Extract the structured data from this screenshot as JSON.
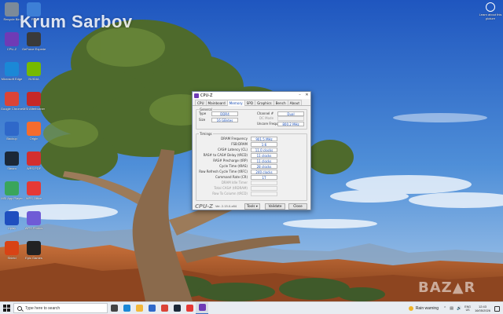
{
  "watermark": {
    "text": "Krum Sarbov"
  },
  "desktop_icons": [
    {
      "label": "Recycle Bin",
      "icon": "recycle-bin-icon",
      "color": "#7c8a99"
    },
    {
      "label": "File",
      "icon": "file-icon",
      "color": "#3d7fd6"
    },
    {
      "label": "CPU-Z",
      "icon": "cpuz-icon",
      "color": "#6f3bb5"
    },
    {
      "label": "GeForce Experience",
      "icon": "geforce-icon",
      "color": "#3a3a3a"
    },
    {
      "label": "Microsoft Edge",
      "icon": "edge-icon",
      "color": "#1b88d6"
    },
    {
      "label": "NVIDIA",
      "icon": "nvidia-icon",
      "color": "#76b900"
    },
    {
      "label": "Google Chrome",
      "icon": "chrome-icon",
      "color": "#db4437"
    },
    {
      "label": "MSI Afterburner",
      "icon": "afterburner-icon",
      "color": "#c62828"
    },
    {
      "label": "Backup",
      "icon": "backup-icon",
      "color": "#2f68c9"
    },
    {
      "label": "Origin",
      "icon": "origin-icon",
      "color": "#f56c2d"
    },
    {
      "label": "Steam",
      "icon": "steam-icon",
      "color": "#1b2838"
    },
    {
      "label": "WPS PDF",
      "icon": "pdf-icon",
      "color": "#d32f2f"
    },
    {
      "label": "MSI App Player",
      "icon": "player-icon",
      "color": "#3aa55b"
    },
    {
      "label": "WPS Office",
      "icon": "wps-icon",
      "color": "#e53935"
    },
    {
      "label": "Uplay",
      "icon": "ubisoft-icon",
      "color": "#1f4fbf"
    },
    {
      "label": "WPS Photos",
      "icon": "photos-icon",
      "color": "#6f5bd6"
    },
    {
      "label": "Shield",
      "icon": "shield-icon",
      "color": "#d84315"
    },
    {
      "label": "Epic Games",
      "icon": "epic-icon",
      "color": "#222222"
    }
  ],
  "account": {
    "label": "Learn about this picture"
  },
  "cpuz": {
    "title": "CPU-Z",
    "tabs": [
      "CPU",
      "Mainboard",
      "Memory",
      "SPD",
      "Graphics",
      "Bench",
      "About"
    ],
    "active_tab": "Memory",
    "general": {
      "label": "General",
      "type_label": "Type",
      "type_value": "DDR4",
      "size_label": "Size",
      "size_value": "16 GBytes",
      "channel_label": "Channel #",
      "channel_value": "Dual",
      "dc_label": "DC Mode",
      "dc_value": "",
      "uncore_label": "Uncore Frequency",
      "uncore_value": "800.2 MHz"
    },
    "timings": {
      "label": "Timings",
      "rows": [
        {
          "label": "DRAM Frequency",
          "value": "901.5 MHz",
          "dim": false
        },
        {
          "label": "FSB:DRAM",
          "value": "1:6",
          "dim": false
        },
        {
          "label": "CAS# Latency (CL)",
          "value": "11.0 clocks",
          "dim": false
        },
        {
          "label": "RAS# to CAS# Delay (tRCD)",
          "value": "11 clocks",
          "dim": false
        },
        {
          "label": "RAS# Precharge (tRP)",
          "value": "11 clocks",
          "dim": false
        },
        {
          "label": "Cycle Time (tRAS)",
          "value": "28 clocks",
          "dim": false
        },
        {
          "label": "Row Refresh Cycle Time (tRFC)",
          "value": "240 clocks",
          "dim": false
        },
        {
          "label": "Command Rate (CR)",
          "value": "1T",
          "dim": false
        },
        {
          "label": "DRAM Idle Timer",
          "value": "",
          "dim": true
        },
        {
          "label": "Total CAS# (tRDRAM)",
          "value": "",
          "dim": true
        },
        {
          "label": "Row To Column (tRCD)",
          "value": "",
          "dim": true
        }
      ]
    },
    "footer": {
      "brand": "CPU-Z",
      "version": "Ver. 2.15.0.x64",
      "tools_label": "Tools",
      "validate_label": "Validate",
      "close_label": "Close"
    }
  },
  "taskbar": {
    "search_placeholder": "Type here to search",
    "pinned": [
      {
        "icon": "task-view-icon",
        "color": "#444444"
      },
      {
        "icon": "edge-icon",
        "color": "#1b88d6"
      },
      {
        "icon": "file-explorer-icon",
        "color": "#f2b73b"
      },
      {
        "icon": "store-icon",
        "color": "#2f68c9"
      },
      {
        "icon": "chrome-icon",
        "color": "#db4437"
      },
      {
        "icon": "steam-icon",
        "color": "#1b2838"
      },
      {
        "icon": "wps-icon",
        "color": "#e53935"
      },
      {
        "icon": "cpuz-icon",
        "color": "#6f3bb5"
      }
    ],
    "weather": "Rain warning",
    "language": "ENG",
    "language_sub": "US",
    "time": "12:43",
    "date": "16/05/2026"
  },
  "colors": {
    "sky_top": "#2a63c8",
    "sky_bottom": "#7fb0e6",
    "window_accent": "#1a4fb8",
    "taskbar": "#e8ecf1"
  }
}
